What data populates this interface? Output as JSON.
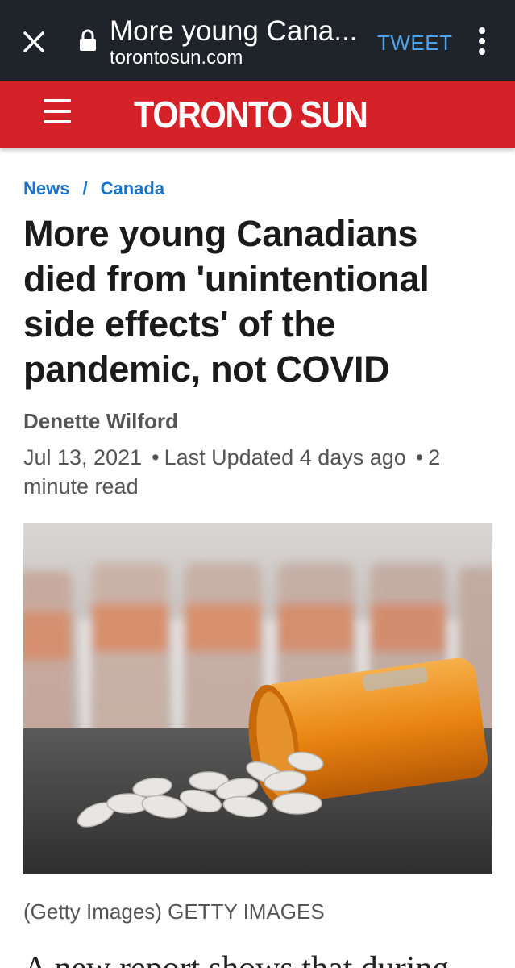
{
  "browser": {
    "page_title": "More young Cana...",
    "domain": "torontosun.com",
    "tweet_label": "TWEET"
  },
  "masthead": {
    "logo_left": "TORONTO",
    "logo_right": "SUN",
    "color": "#d52128"
  },
  "article": {
    "breadcrumb": [
      "News",
      "Canada"
    ],
    "breadcrumb_separator": "/",
    "headline": "More young Canadians died from 'unintentional side effects' of the pandemic, not COVID",
    "author": "Denette Wilford",
    "date": "Jul 13, 2021",
    "updated": "Last Updated 4 days ago",
    "read_time": "2 minute read",
    "photo_caption": "(Getty Images) GETTY IMAGES",
    "body_start": "A new report shows that during"
  },
  "icons": [
    "close-icon",
    "lock-icon",
    "more-vertical-icon",
    "menu-icon"
  ]
}
